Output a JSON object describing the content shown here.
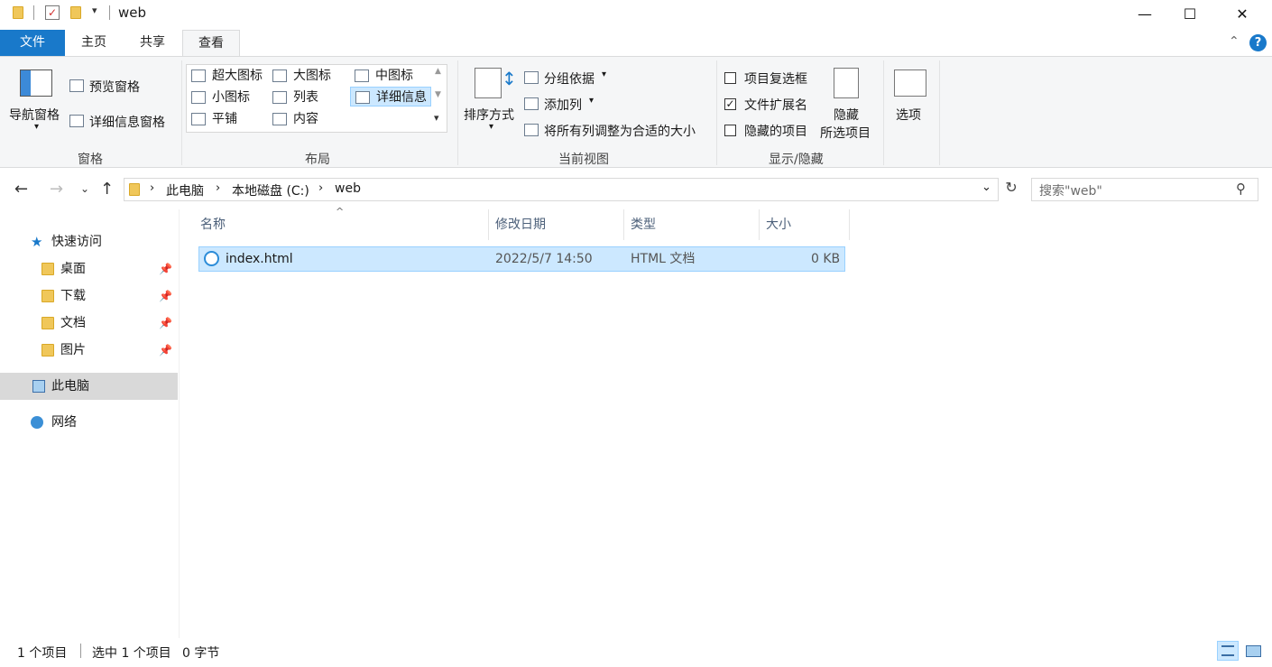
{
  "window": {
    "title": "web",
    "controls": {
      "minimize": "—",
      "maximize": "☐",
      "close": "✕"
    }
  },
  "tabs": {
    "file": "文件",
    "home": "主页",
    "share": "共享",
    "view": "查看"
  },
  "ribbon": {
    "panes": {
      "nav_pane": "导航窗格",
      "preview_pane": "预览窗格",
      "details_pane": "详细信息窗格",
      "group_label": "窗格"
    },
    "layout": {
      "extra_large": "超大图标",
      "large": "大图标",
      "medium": "中图标",
      "small": "小图标",
      "list": "列表",
      "details": "详细信息",
      "tiles": "平铺",
      "content": "内容",
      "group_label": "布局"
    },
    "current_view": {
      "sort_by": "排序方式",
      "group_by": "分组依据",
      "add_column": "添加列",
      "size_all_columns": "将所有列调整为合适的大小",
      "group_label": "当前视图"
    },
    "show_hide": {
      "item_checkboxes": "项目复选框",
      "item_checkboxes_checked": false,
      "file_extensions": "文件扩展名",
      "file_extensions_checked": true,
      "hidden_items": "隐藏的项目",
      "hidden_items_checked": false,
      "hide_selected_line1": "隐藏",
      "hide_selected_line2": "所选项目",
      "group_label": "显示/隐藏"
    },
    "options": "选项"
  },
  "address": {
    "breadcrumb": [
      "此电脑",
      "本地磁盘 (C:)",
      "web"
    ],
    "search_placeholder": "搜索\"web\""
  },
  "sidebar": {
    "quick_access": "快速访问",
    "items": [
      {
        "label": "桌面",
        "icon": "desktop-folder-icon",
        "pinned": true
      },
      {
        "label": "下载",
        "icon": "download-folder-icon",
        "pinned": true
      },
      {
        "label": "文档",
        "icon": "documents-folder-icon",
        "pinned": true
      },
      {
        "label": "图片",
        "icon": "pictures-folder-icon",
        "pinned": true
      }
    ],
    "this_pc": "此电脑",
    "network": "网络"
  },
  "file_list": {
    "columns": {
      "name": "名称",
      "date": "修改日期",
      "type": "类型",
      "size": "大小"
    },
    "rows": [
      {
        "name": "index.html",
        "date": "2022/5/7 14:50",
        "type": "HTML 文档",
        "size": "0 KB",
        "selected": true
      }
    ]
  },
  "status": {
    "item_count": "1 个项目",
    "selected": "选中 1 个项目",
    "selected_size": "0 字节"
  },
  "colors": {
    "accent": "#1979ca",
    "selection": "#cce8ff",
    "selection_border": "#99d1ff",
    "help": "#1979ca"
  }
}
